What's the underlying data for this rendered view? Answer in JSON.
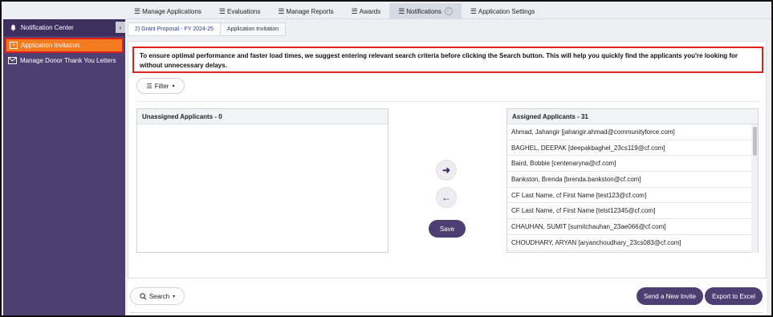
{
  "topnav": {
    "items": [
      {
        "label": "Manage Applications"
      },
      {
        "label": "Evaluations"
      },
      {
        "label": "Manage Reports"
      },
      {
        "label": "Awards"
      },
      {
        "label": "Notifications",
        "active": true
      },
      {
        "label": "Application Settings"
      }
    ]
  },
  "sidebar": {
    "header": "Notification Center",
    "collapse_glyph": "‹",
    "items": [
      {
        "label": "Application Invitation",
        "active": true
      },
      {
        "label": "Manage Donor Thank You Letters"
      }
    ]
  },
  "breadcrumb": {
    "first": "2) Grant Proposal - FY 2024-25",
    "second": "Application Invitation"
  },
  "notice": "To ensure optimal performance and faster load times, we suggest entering relevant search criteria before clicking the Search button. This will help you quickly find the applicants you're looking for without unnecessary delays.",
  "filter_label": "Filter",
  "unassigned": {
    "title": "Unassigned Applicants - 0"
  },
  "assigned": {
    "title": "Assigned Applicants - 31",
    "rows": [
      "Ahmad, Jahangir [jahangir.ahmad@communityforce.com]",
      "BAGHEL, DEEPAK [deepakbaghel_23cs119@cf.com]",
      "Baird, Bobbie [centenaryna@cf.com]",
      "Bankston, Brenda [brenda.bankston@cf.com]",
      "CF Last Name, cf First Name [test123@cf.com]",
      "CF Last Name, cf First Name [tetst12345@cf.com]",
      "CHAUHAN, SUMIT [sumitchauhan_23ae066@cf.com]",
      "CHOUDHARY, ARYAN [aryanchoudhary_23cs083@cf.com]"
    ]
  },
  "buttons": {
    "move_right": "➜",
    "move_left": "←",
    "save": "Save",
    "search": "Search",
    "send_invite": "Send a New Invite",
    "export": "Export to Excel"
  },
  "colors": {
    "brand_purple": "#4e3f72",
    "active_orange": "#f47a20",
    "alert_red": "#e0201a"
  }
}
